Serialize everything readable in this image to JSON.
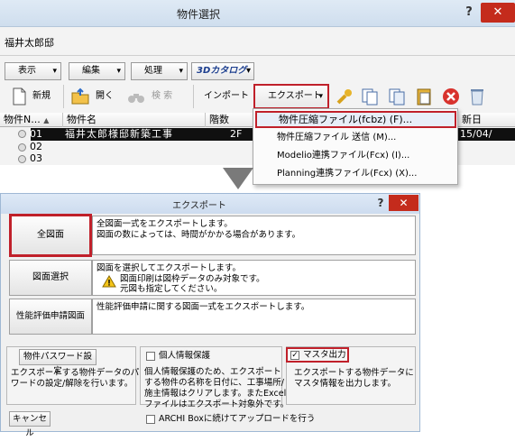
{
  "top_window": {
    "title": "物件選択",
    "help": "?",
    "close": "✕",
    "user": "福井太郎邸",
    "menus": [
      {
        "label": "表示",
        "arrow": "▾"
      },
      {
        "label": "編集",
        "arrow": "▾"
      },
      {
        "label": "処理",
        "arrow": "▾"
      },
      {
        "label": "3Dカタログ",
        "arrow": "▾"
      }
    ],
    "toolbar": {
      "new": "新規",
      "open": "開く",
      "search": "検 索",
      "import": "インポート",
      "export": "エクスポート",
      "export_arrow": "▾"
    },
    "columns": {
      "no": "物件N...",
      "sort_arrow": "▲",
      "name": "物件名",
      "floors": "階数",
      "date": "新日"
    },
    "rows": [
      {
        "no": "01",
        "name": "福井太郎様邸新築工事",
        "floors": "2F",
        "date": "15/04/"
      },
      {
        "no": "02"
      },
      {
        "no": "03"
      }
    ],
    "export_menu": [
      "物件圧縮ファイル(fcbz) (F)...",
      "物件圧縮ファイル 送信 (M)...",
      "Modelio連携ファイル(Fcx) (I)...",
      "Planning連携ファイル(Fcx) (X)..."
    ]
  },
  "dialog": {
    "title": "エクスポート",
    "help": "?",
    "close": "✕",
    "options": [
      {
        "label": "全図面",
        "desc": [
          "全図面一式をエクスポートします。",
          "図面の数によっては、時間がかかる場合があります。"
        ]
      },
      {
        "label": "図面選択",
        "desc": [
          "図面を選択してエクスポートします。"
        ],
        "warning": [
          "図面印刷は図枠データのみ対象です。",
          "元図も指定してください。"
        ]
      },
      {
        "label": "性能評価申請図面",
        "desc": [
          "性能評価申請に関する図面一式をエクスポートします。"
        ]
      }
    ],
    "password": {
      "button": "物件パスワード設定",
      "desc": [
        "エクスポートする物件データのパス",
        "ワードの設定/解除を行います。"
      ]
    },
    "privacy": {
      "label": "個人情報保護",
      "checked": false,
      "desc": [
        "個人情報保護のため、エクスポート",
        "する物件の名称を日付に、工事場所/",
        "施主情報はクリアします。またExcel",
        "ファイルはエクスポート対象外です。"
      ]
    },
    "master": {
      "label": "マスタ出力",
      "checked": true,
      "check_glyph": "✓",
      "desc": [
        "エクスポートする物件データに",
        "マスタ情報を出力します。"
      ]
    },
    "cancel": "キャンセル",
    "archi": {
      "label": "ARCHI Boxに続けてアップロードを行う",
      "checked": false
    }
  },
  "colors": {
    "highlight": "#c0202a",
    "title_bg": "#d6e4f2",
    "close_bg": "#c42b1c"
  }
}
